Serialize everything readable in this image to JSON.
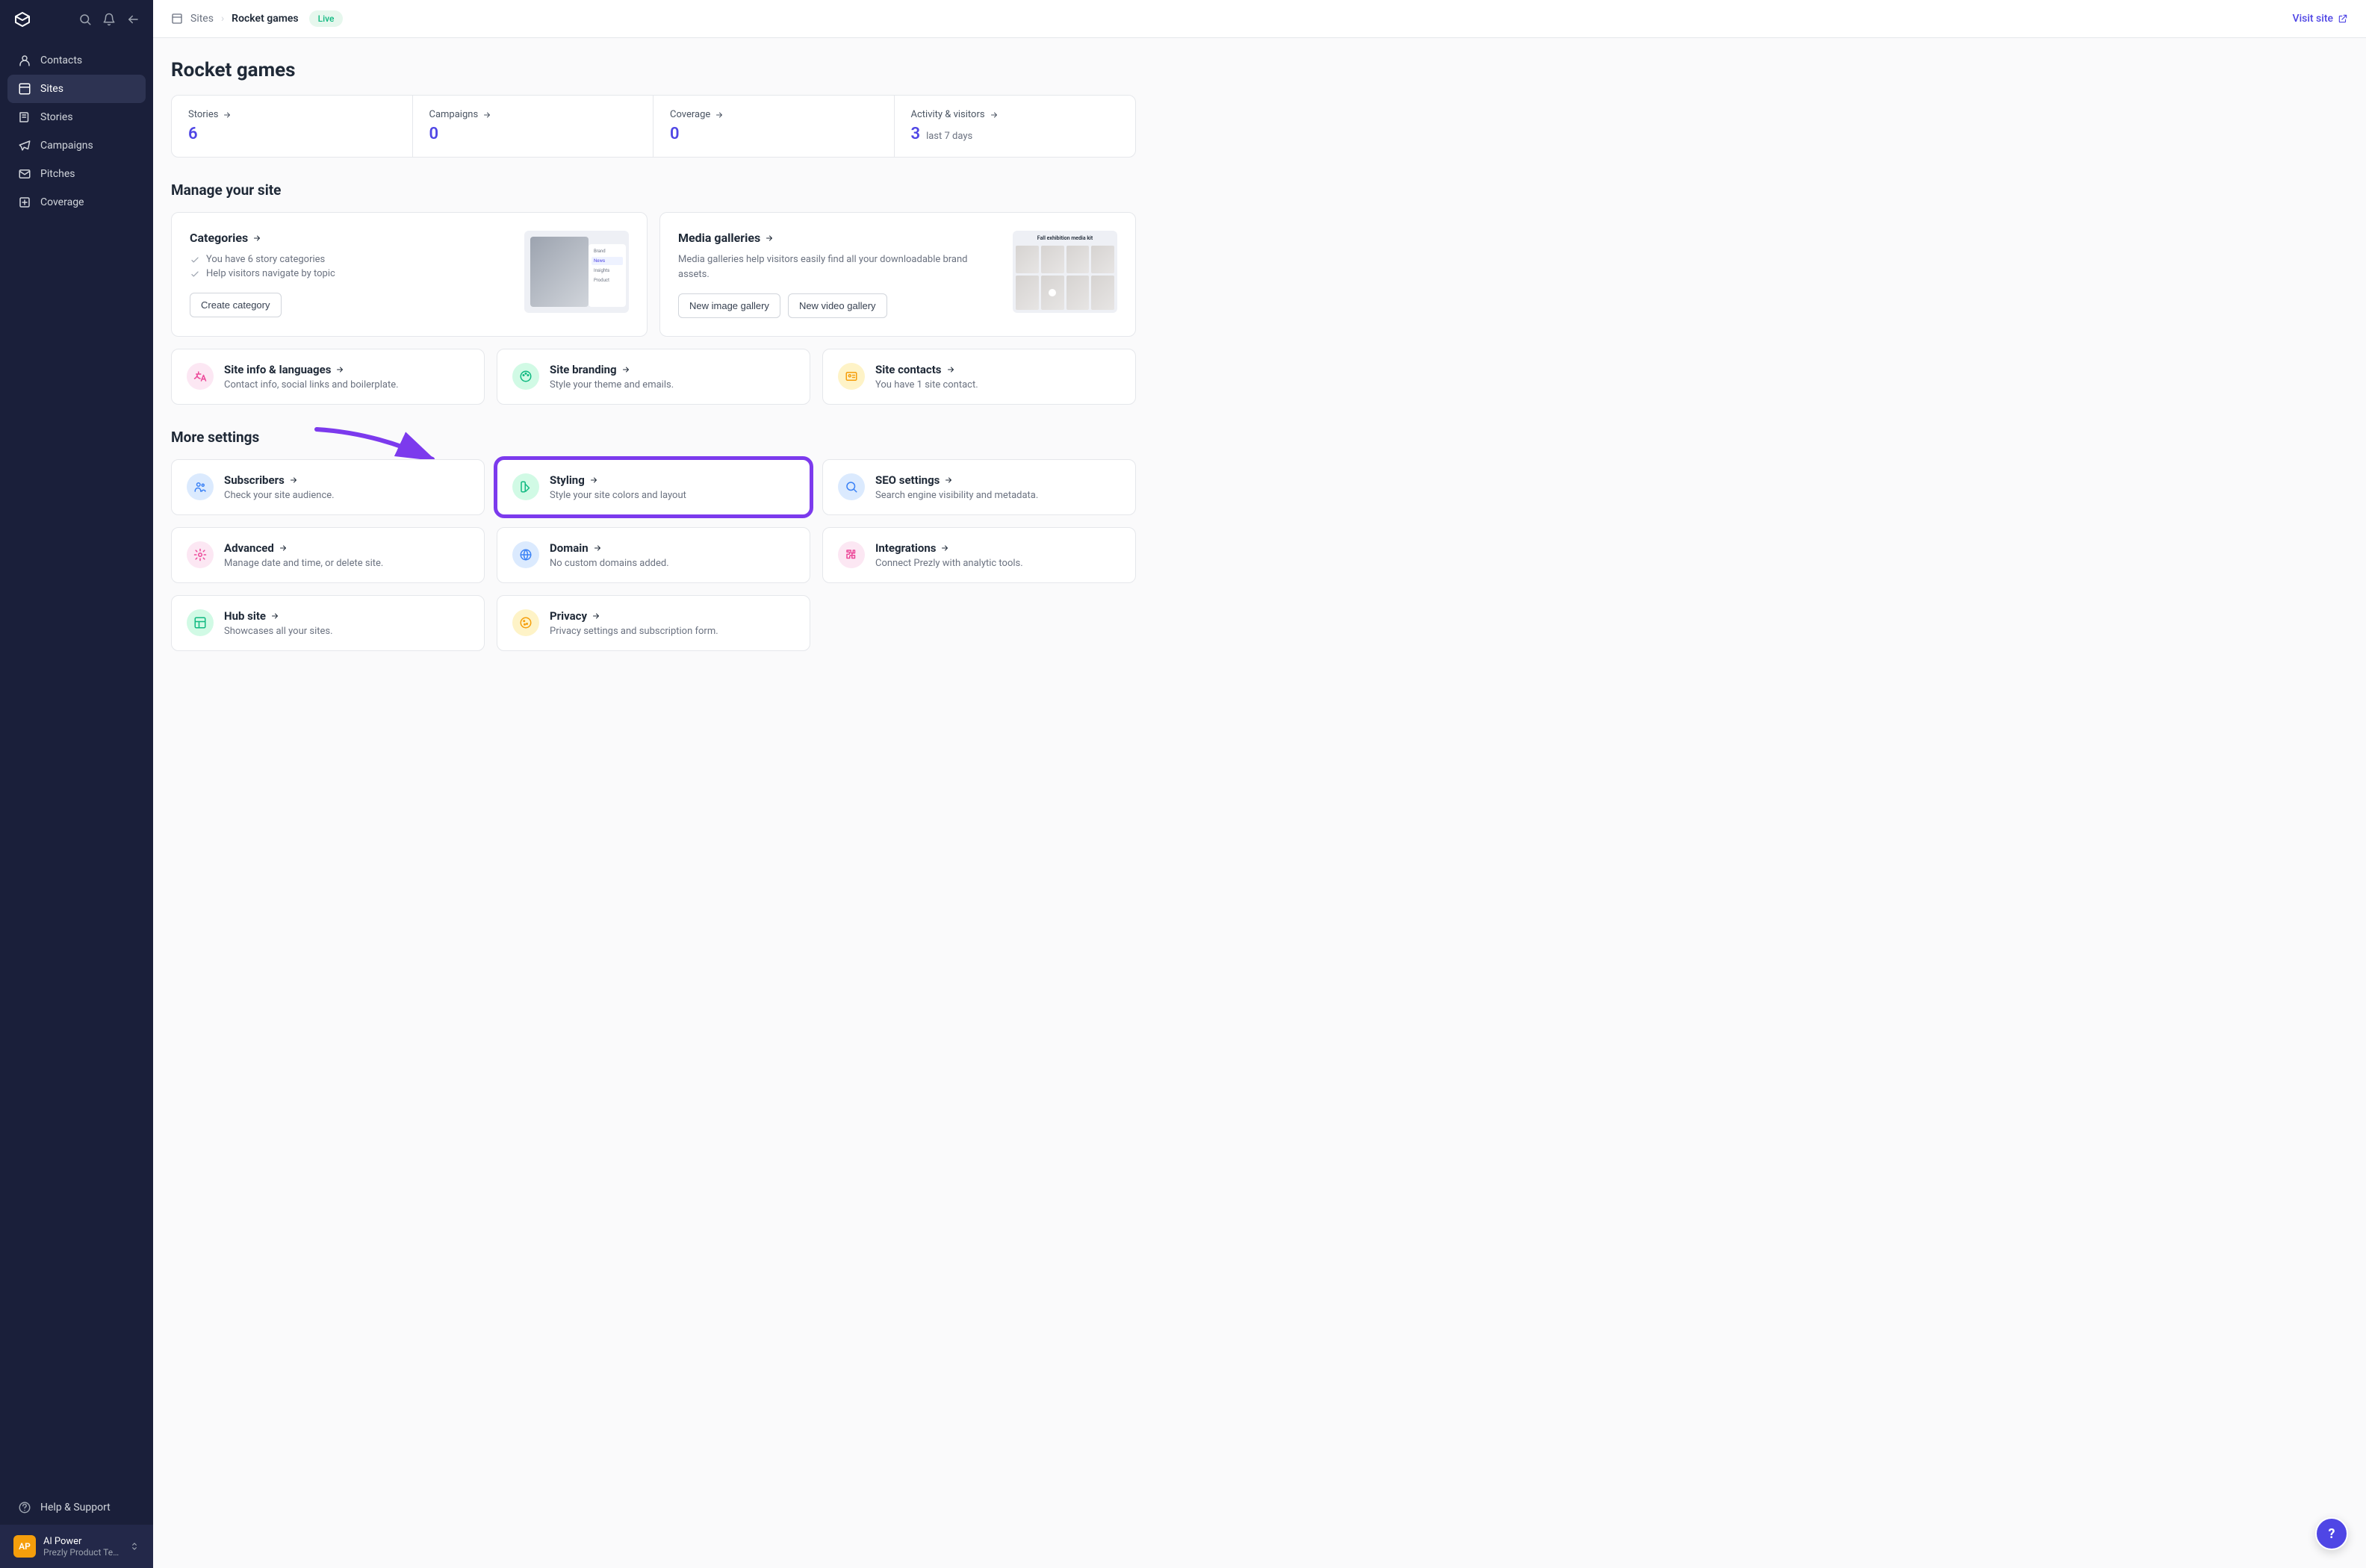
{
  "sidebar": {
    "nav": [
      {
        "label": "Contacts"
      },
      {
        "label": "Sites"
      },
      {
        "label": "Stories"
      },
      {
        "label": "Campaigns"
      },
      {
        "label": "Pitches"
      },
      {
        "label": "Coverage"
      }
    ],
    "help": "Help & Support",
    "user": {
      "initials": "AP",
      "name": "Al Power",
      "team": "Prezly Product Tea..."
    }
  },
  "breadcrumb": {
    "root": "Sites",
    "current": "Rocket games",
    "badge": "Live"
  },
  "visit": "Visit site",
  "page_title": "Rocket games",
  "stats": [
    {
      "label": "Stories",
      "value": "6"
    },
    {
      "label": "Campaigns",
      "value": "0"
    },
    {
      "label": "Coverage",
      "value": "0"
    },
    {
      "label": "Activity & visitors",
      "value": "3",
      "sub": "last 7 days"
    }
  ],
  "manage": {
    "title": "Manage your site",
    "categories": {
      "title": "Categories",
      "check1": "You have 6 story categories",
      "check2": "Help visitors navigate by topic",
      "button": "Create category",
      "thumb_menu": [
        "Brand",
        "News",
        "Insights",
        "Product"
      ]
    },
    "galleries": {
      "title": "Media galleries",
      "desc": "Media galleries help visitors easily find all your downloadable brand assets.",
      "btn1": "New image gallery",
      "btn2": "New video gallery",
      "thumb_title": "Fall exhibition media kit"
    },
    "tiles": [
      {
        "title": "Site info & languages",
        "desc": "Contact info, social links and boilerplate.",
        "color": "pink",
        "icon": "translate"
      },
      {
        "title": "Site branding",
        "desc": "Style your theme and emails.",
        "color": "green",
        "icon": "palette"
      },
      {
        "title": "Site contacts",
        "desc": "You have 1 site contact.",
        "color": "orange",
        "icon": "id"
      }
    ]
  },
  "more": {
    "title": "More settings",
    "tiles": [
      {
        "title": "Subscribers",
        "desc": "Check your site audience.",
        "color": "blue",
        "icon": "users"
      },
      {
        "title": "Styling",
        "desc": "Style your site colors and layout",
        "color": "green",
        "icon": "swatch",
        "highlight": true
      },
      {
        "title": "SEO settings",
        "desc": "Search engine visibility and metadata.",
        "color": "blue",
        "icon": "search"
      },
      {
        "title": "Advanced",
        "desc": "Manage date and time, or delete site.",
        "color": "pink",
        "icon": "gear"
      },
      {
        "title": "Domain",
        "desc": "No custom domains added.",
        "color": "blue",
        "icon": "globe"
      },
      {
        "title": "Integrations",
        "desc": "Connect Prezly with analytic tools.",
        "color": "pink",
        "icon": "puzzle"
      },
      {
        "title": "Hub site",
        "desc": "Showcases all your sites.",
        "color": "green",
        "icon": "layout"
      },
      {
        "title": "Privacy",
        "desc": "Privacy settings and subscription form.",
        "color": "orange",
        "icon": "cookie"
      }
    ]
  },
  "help_fab": "?"
}
